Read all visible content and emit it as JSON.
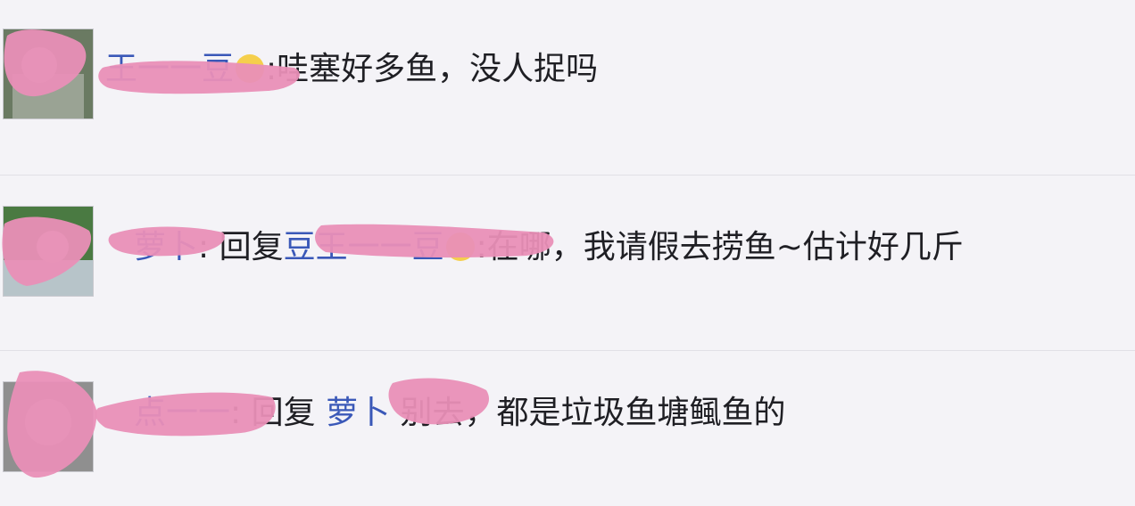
{
  "comments": [
    {
      "user": "王一一豆",
      "separator": ":",
      "text": "哇塞好多鱼，没人捉吗"
    },
    {
      "user": "萝卜",
      "separator": ": ",
      "reply_label": "回复",
      "reply_to": "豆王一一豆",
      "reply_separator": ":",
      "text": "在哪，我请假去捞鱼~估计好几斤"
    },
    {
      "user": "点一一",
      "separator": ": ",
      "reply_label": "回复",
      "reply_to": "萝卜",
      "reply_separator": " ",
      "text": "别去，都是垃圾鱼塘鲺鱼的"
    }
  ],
  "colors": {
    "background": "#f4f3f7",
    "username": "#3a58b8",
    "text": "#1f1f24",
    "redaction": "#e98fb7"
  },
  "icons": [
    "emoji-icon",
    "avatar-image"
  ]
}
